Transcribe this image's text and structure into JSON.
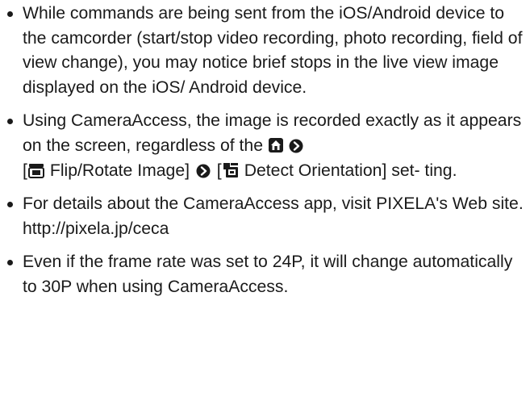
{
  "bullets": [
    {
      "text": "While commands are being sent from the iOS/Android device to the camcorder (start/stop video recording, photo recording, field of view change), you may notice brief stops in the live view image displayed on the iOS/ Android device."
    },
    {
      "part1": "Using CameraAccess, the image is recorded exactly as it appears on the screen, regardless of the",
      "bracket_open_1": "[",
      "flip_label": "Flip/Rotate Image]",
      "bracket_open_2": "[",
      "orient_label": "Detect Orientation] set- ting.",
      "icons": [
        "home-icon",
        "arrow-icon",
        "flip-rotate-menu-icon",
        "arrow-icon",
        "detect-orientation-menu-icon"
      ]
    },
    {
      "text": "For details about the CameraAccess app, visit PIXELA's Web site.",
      "url": "http://pixela.jp/ceca"
    },
    {
      "text": "Even if the frame rate was set to 24P, it will change automatically to 30P when using CameraAccess."
    }
  ]
}
